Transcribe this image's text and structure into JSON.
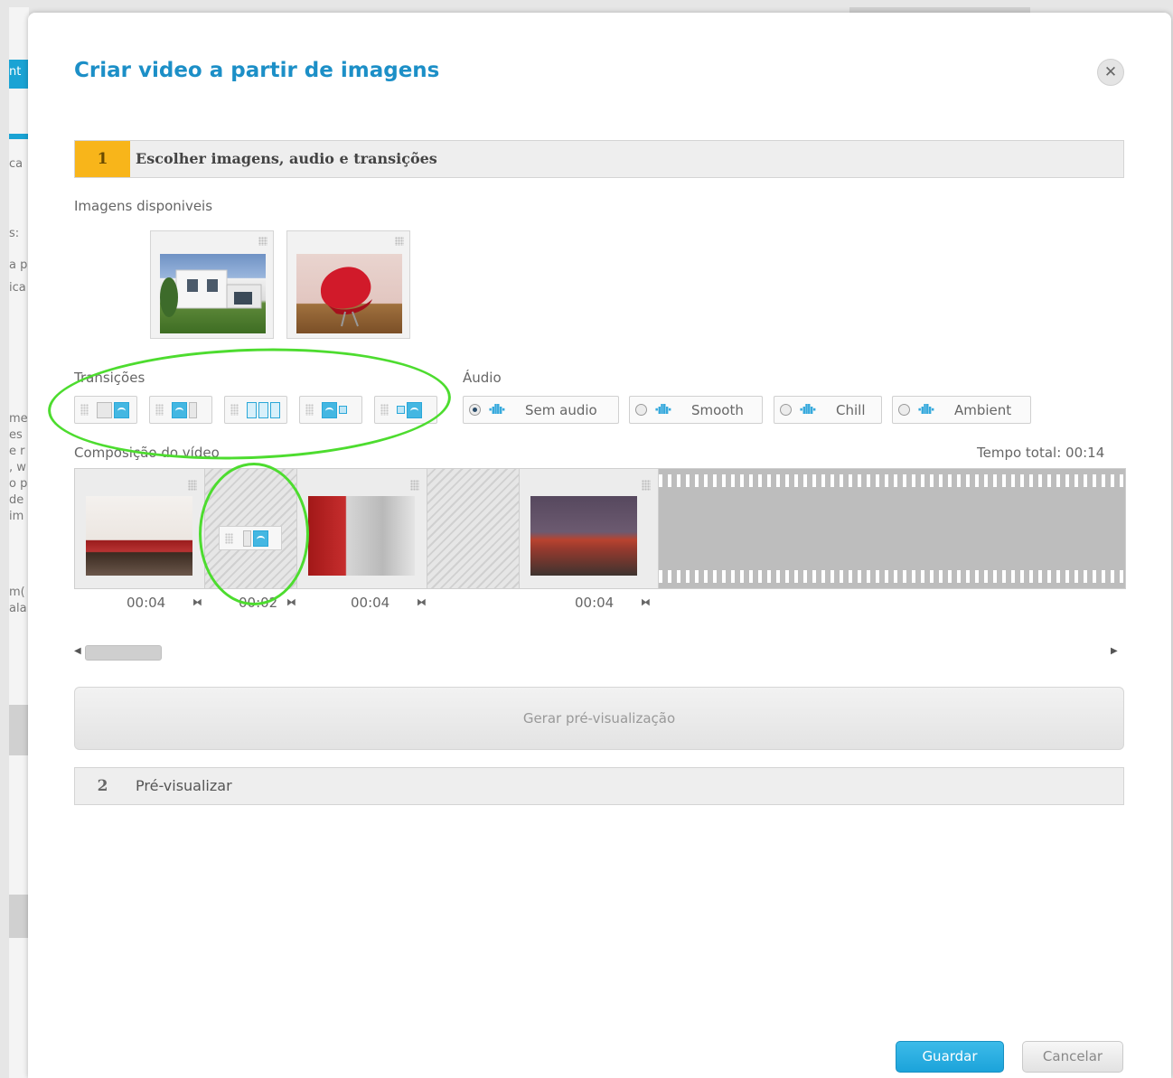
{
  "background": {
    "tab_label": "nt",
    "fragments": [
      "ca",
      "s:",
      "a p",
      "ica",
      "me",
      "es",
      "e r",
      ", w",
      "o p",
      "de",
      "im",
      "m(",
      "ala"
    ]
  },
  "modal": {
    "title": "Criar video a partir de imagens",
    "close_icon": "close-icon"
  },
  "step1": {
    "number": "1",
    "label": "Escolher imagens, audio e transições"
  },
  "available_images": {
    "label": "Imagens disponiveis",
    "items": [
      {
        "name": "house-photo"
      },
      {
        "name": "red-chair-photo"
      }
    ]
  },
  "transitions": {
    "label": "Transições",
    "items": [
      "fade",
      "crossfade",
      "slide-grid",
      "zoom-out",
      "zoom-in"
    ]
  },
  "audio": {
    "label": "Áudio",
    "options": [
      {
        "label": "Sem audio",
        "selected": true
      },
      {
        "label": "Smooth",
        "selected": false
      },
      {
        "label": "Chill",
        "selected": false
      },
      {
        "label": "Ambient",
        "selected": false
      }
    ]
  },
  "composition": {
    "label": "Composição do vídeo",
    "total_time_label": "Tempo total: 00:14",
    "durations": [
      "00:04",
      "00:02",
      "00:04",
      "00:04"
    ],
    "duration_icon": "⧓"
  },
  "preview_button": "Gerar pré-visualização",
  "step2": {
    "number": "2",
    "label": "Pré-visualizar"
  },
  "footer": {
    "save": "Guardar",
    "cancel": "Cancelar"
  },
  "colors": {
    "accent": "#1c8fc7",
    "step_active": "#f8b51a",
    "annotation": "#4ddc2f",
    "primary_button": "#1ca3da"
  }
}
